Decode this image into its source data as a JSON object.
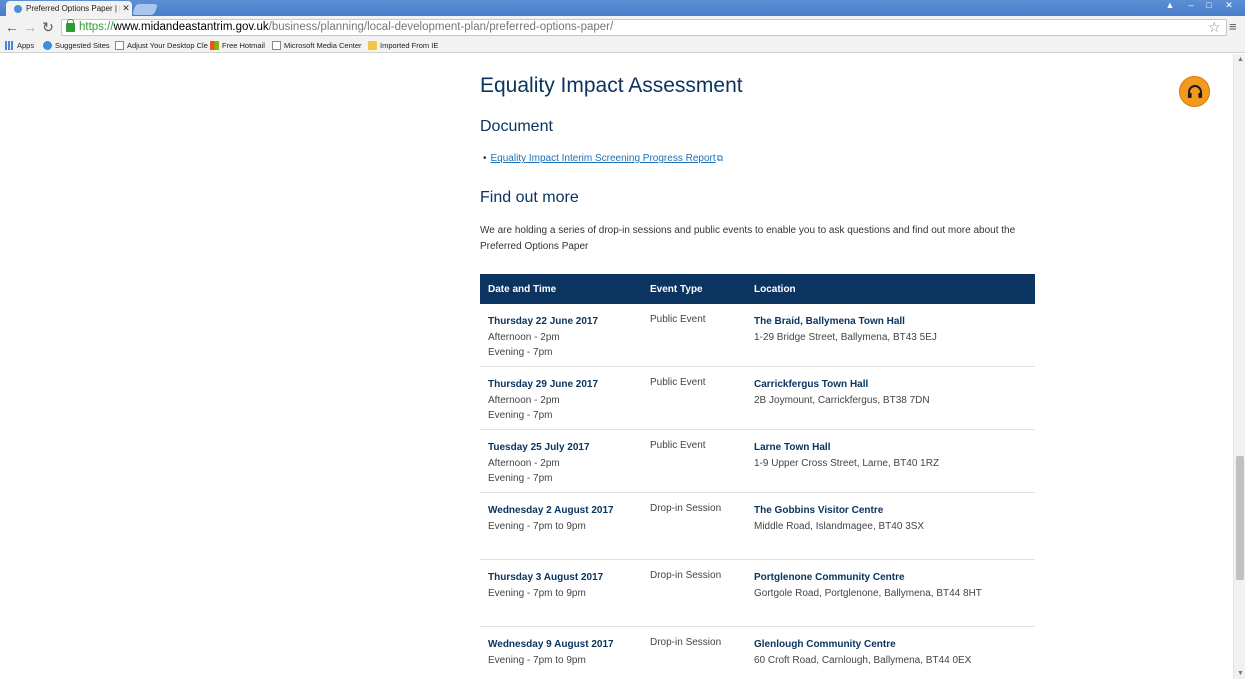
{
  "browser": {
    "tab_title": "Preferred Options Paper | M",
    "tab_close": "✕",
    "url_scheme": "https://",
    "url_host": "www.midandeastantrim.gov.uk",
    "url_path": "/business/planning/local-development-plan/preferred-options-paper/",
    "bookmarks": [
      {
        "label": "Apps",
        "icon": "apps-icon"
      },
      {
        "label": "Suggested Sites",
        "icon": "ie-icon"
      },
      {
        "label": "Adjust Your Desktop Cle",
        "icon": "page-icon"
      },
      {
        "label": "Free Hotmail",
        "icon": "microsoft-icon"
      },
      {
        "label": "Microsoft Media Center",
        "icon": "page-icon"
      },
      {
        "label": "Imported From IE",
        "icon": "folder-icon"
      }
    ]
  },
  "page": {
    "title": "Equality Impact Assessment",
    "document_heading": "Document",
    "document_link": "Equality Impact Interim Screening Progress Report",
    "find_out_more_heading": "Find out more",
    "intro": "We are holding a series of drop-in sessions and public events to enable you to ask questions and find out more about the Preferred Options Paper"
  },
  "events": {
    "headers": [
      "Date and Time",
      "Event Type",
      "Location"
    ],
    "rows": [
      {
        "date": "Thursday 22 June 2017",
        "times": [
          "Afternoon - 2pm",
          "Evening - 7pm"
        ],
        "type": "Public Event",
        "venue": "The Braid, Ballymena Town Hall",
        "address": "1-29 Bridge Street, Ballymena, BT43 5EJ"
      },
      {
        "date": "Thursday 29 June 2017",
        "times": [
          "Afternoon - 2pm",
          "Evening - 7pm"
        ],
        "type": "Public Event",
        "venue": "Carrickfergus Town Hall",
        "address": "2B Joymount, Carrickfergus, BT38 7DN"
      },
      {
        "date": "Tuesday 25 July 2017",
        "times": [
          "Afternoon - 2pm",
          "Evening - 7pm"
        ],
        "type": "Public Event",
        "venue": "Larne Town Hall",
        "address": "1-9 Upper Cross Street, Larne, BT40 1RZ"
      },
      {
        "date": "Wednesday 2 August 2017",
        "times": [
          "Evening - 7pm to 9pm"
        ],
        "type": "Drop-in Session",
        "venue": "The Gobbins Visitor Centre",
        "address": "Middle Road, Islandmagee, BT40 3SX"
      },
      {
        "date": "Thursday 3 August 2017",
        "times": [
          "Evening - 7pm to 9pm"
        ],
        "type": "Drop-in Session",
        "venue": "Portglenone Community Centre",
        "address": "Gortgole Road, Portglenone, Ballymena, BT44 8HT"
      },
      {
        "date": "Wednesday 9 August 2017",
        "times": [
          "Evening - 7pm to 9pm"
        ],
        "type": "Drop-in Session",
        "venue": "Glenlough Community Centre",
        "address": "60 Croft Road, Carnlough, Ballymena, BT44 0EX"
      }
    ]
  },
  "colors": {
    "brand_navy": "#0b3560",
    "link_blue": "#1d6fb8",
    "assist_orange": "#f39a1e"
  }
}
